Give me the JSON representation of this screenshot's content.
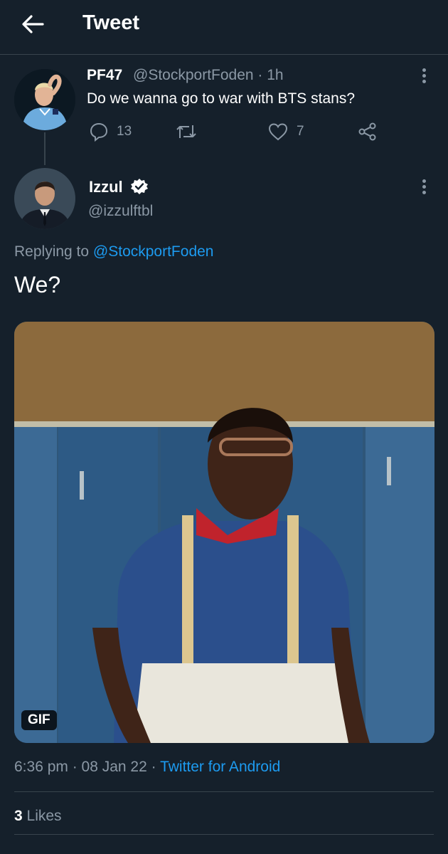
{
  "header": {
    "title": "Tweet"
  },
  "parent_tweet": {
    "display_name": "PF47",
    "handle_time": "@StockportFoden · 1h",
    "text": "Do we wanna go to war with BTS stans?",
    "reply_count": "13",
    "like_count": "7"
  },
  "main_tweet": {
    "display_name": "Izzul",
    "handle": "@izzulftbl",
    "replying_prefix": "Replying to ",
    "replying_to": "@StockportFoden",
    "text": "We?",
    "media_badge": "GIF",
    "time": "6:36 pm · 08 Jan 22 · ",
    "source": "Twitter for Android",
    "likes_count": "3",
    "likes_label": " Likes"
  },
  "colors": {
    "background": "#15202b",
    "accent": "#1d9bf0",
    "muted": "#8b98a5",
    "divider": "#38444d"
  },
  "icons": [
    "back-arrow-icon",
    "more-icon",
    "reply-icon",
    "retweet-icon",
    "like-icon",
    "share-icon",
    "verified-icon"
  ]
}
